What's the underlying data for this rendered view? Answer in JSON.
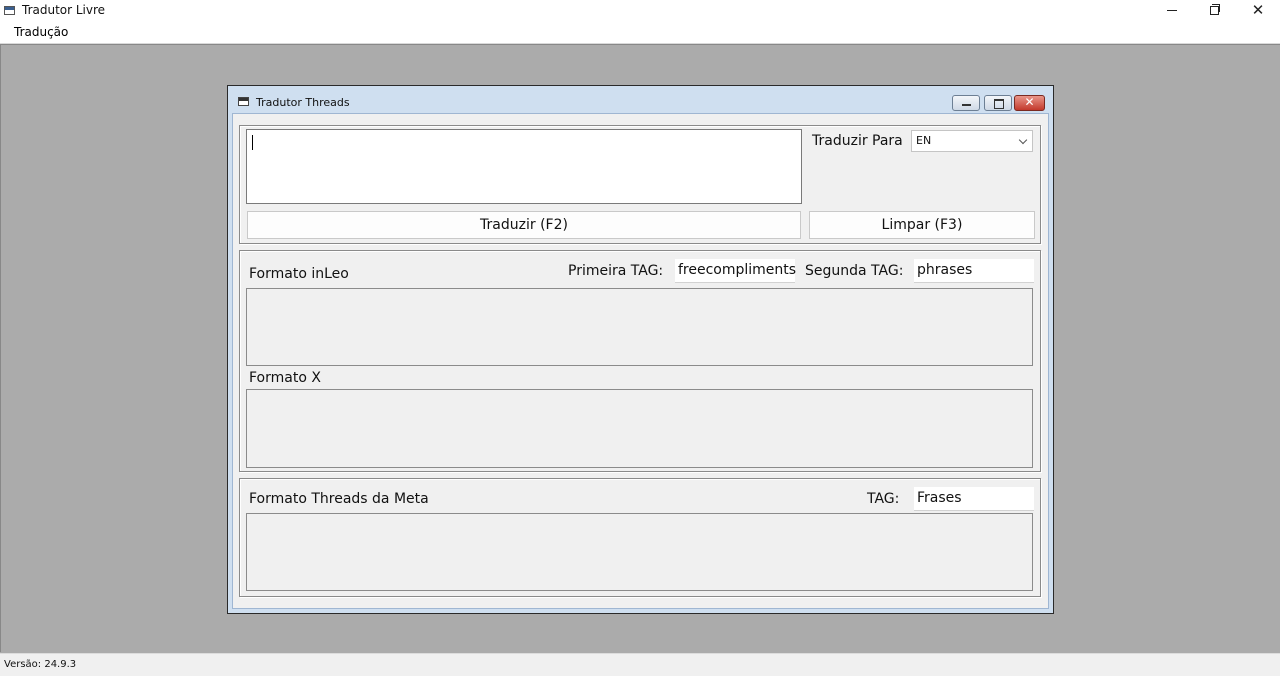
{
  "app": {
    "title": "Tradutor Livre",
    "menu": [
      "Tradução"
    ],
    "status": "Versão: 24.9.3"
  },
  "child": {
    "title": "Tradutor Threads",
    "input_text": "",
    "translate_to_label": "Traduzir Para",
    "language_selected": "EN",
    "translate_button": "Traduzir (F2)",
    "clear_button": "Limpar (F3)"
  },
  "inleo": {
    "label": "Formato inLeo",
    "first_tag_label": "Primeira TAG:",
    "first_tag_value": "freecompliments",
    "second_tag_label": "Segunda TAG:",
    "second_tag_value": "phrases",
    "output": ""
  },
  "x_format": {
    "label": "Formato X",
    "output": ""
  },
  "threads": {
    "label": "Formato Threads da Meta",
    "tag_label": "TAG:",
    "tag_value": "Frases",
    "output": ""
  },
  "icons": [
    "app-icon",
    "minimize-icon",
    "maximize-icon",
    "close-icon",
    "chevron-down-icon"
  ]
}
